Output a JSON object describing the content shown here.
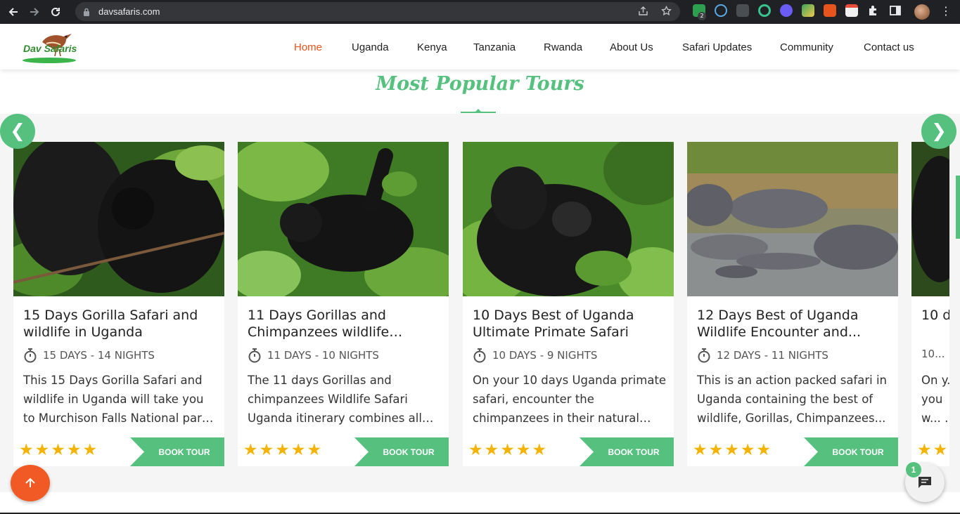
{
  "browser": {
    "url": "davsafaris.com",
    "extension_badge": "2"
  },
  "site": {
    "logo_text": "Dav Safaris",
    "nav": [
      {
        "label": "Home",
        "active": true
      },
      {
        "label": "Uganda"
      },
      {
        "label": "Kenya"
      },
      {
        "label": "Tanzania"
      },
      {
        "label": "Rwanda"
      },
      {
        "label": "About Us"
      },
      {
        "label": "Safari Updates"
      },
      {
        "label": "Community"
      },
      {
        "label": "Contact us"
      }
    ]
  },
  "section": {
    "title": "Most Popular Tours",
    "prev_arrow": "❮",
    "next_arrow": "❯"
  },
  "tours": [
    {
      "title": "15 Days Gorilla Safari and wildlife in Uganda",
      "duration": "15 DAYS - 14 NIGHTS",
      "description": "This 15 Days Gorilla Safari and wildlife in Uganda will take you to Murchison Falls National park fo...",
      "rating": 5,
      "button": "BOOK TOUR",
      "image": "gorilla-pair-photo"
    },
    {
      "title": "11 Days Gorillas and Chimpanzees wildlife Safari...",
      "duration": "11 DAYS - 10 NIGHTS",
      "description": "The 11 days Gorillas and chimpanzees Wildlife Safari Uganda itinerary combines all th...",
      "rating": 5,
      "button": "BOOK TOUR",
      "image": "young-gorilla-photo"
    },
    {
      "title": "10 Days Best of Uganda Ultimate Primate Safari",
      "duration": "10 DAYS - 9 NIGHTS",
      "description": "On your 10 days Uganda primate safari, encounter the chimpanzees in their natural habitat in Kibale...",
      "rating": 5,
      "button": "BOOK TOUR",
      "image": "gorilla-mother-baby-photo"
    },
    {
      "title": "12 Days Best of Uganda Wildlife Encounter and...",
      "duration": "12 DAYS - 11 NIGHTS",
      "description": "This is an action packed safari in Uganda containing the best of wildlife, Gorillas, Chimpanzees...",
      "rating": 5,
      "button": "BOOK TOUR",
      "image": "hippos-photo"
    },
    {
      "title": "10 da... Wild...",
      "duration": "10...",
      "description": "On y... you w... Big f...",
      "rating": 5,
      "button": "BOOK TOUR",
      "image": "gorilla-photo-partial"
    }
  ],
  "widgets": {
    "scroll_top_icon": "arrow-up-icon",
    "chat_icon": "chat-icon",
    "chat_badge": "1"
  },
  "colors": {
    "accent_green": "#56c07f",
    "star": "#f5b301",
    "scroll_top": "#f15a24",
    "nav_active": "#e8541e"
  }
}
